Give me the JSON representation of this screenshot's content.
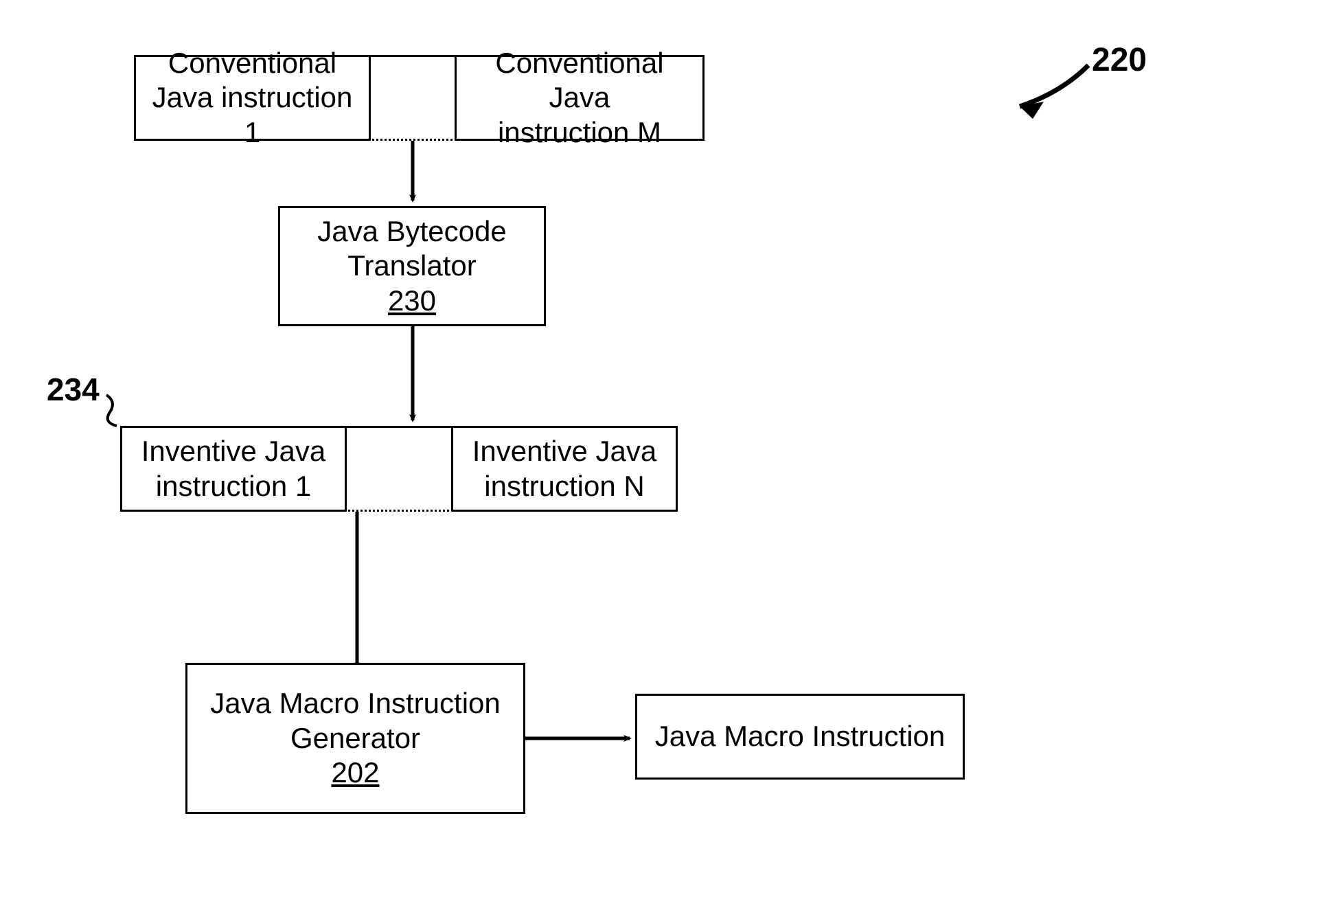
{
  "figure_label": "220",
  "callout_label": "234",
  "boxes": {
    "conv1": {
      "lines": [
        "Conventional",
        "Java instruction 1"
      ]
    },
    "convM": {
      "lines": [
        "Conventional Java",
        "instruction M"
      ]
    },
    "translator": {
      "lines": [
        "Java Bytecode",
        "Translator"
      ],
      "ref": "230"
    },
    "inv1": {
      "lines": [
        "Inventive Java",
        "instruction 1"
      ]
    },
    "invN": {
      "lines": [
        "Inventive Java",
        "instruction N"
      ]
    },
    "generator": {
      "lines": [
        "Java Macro Instruction",
        "Generator"
      ],
      "ref": "202"
    },
    "output": {
      "lines": [
        "Java Macro Instruction"
      ]
    }
  }
}
